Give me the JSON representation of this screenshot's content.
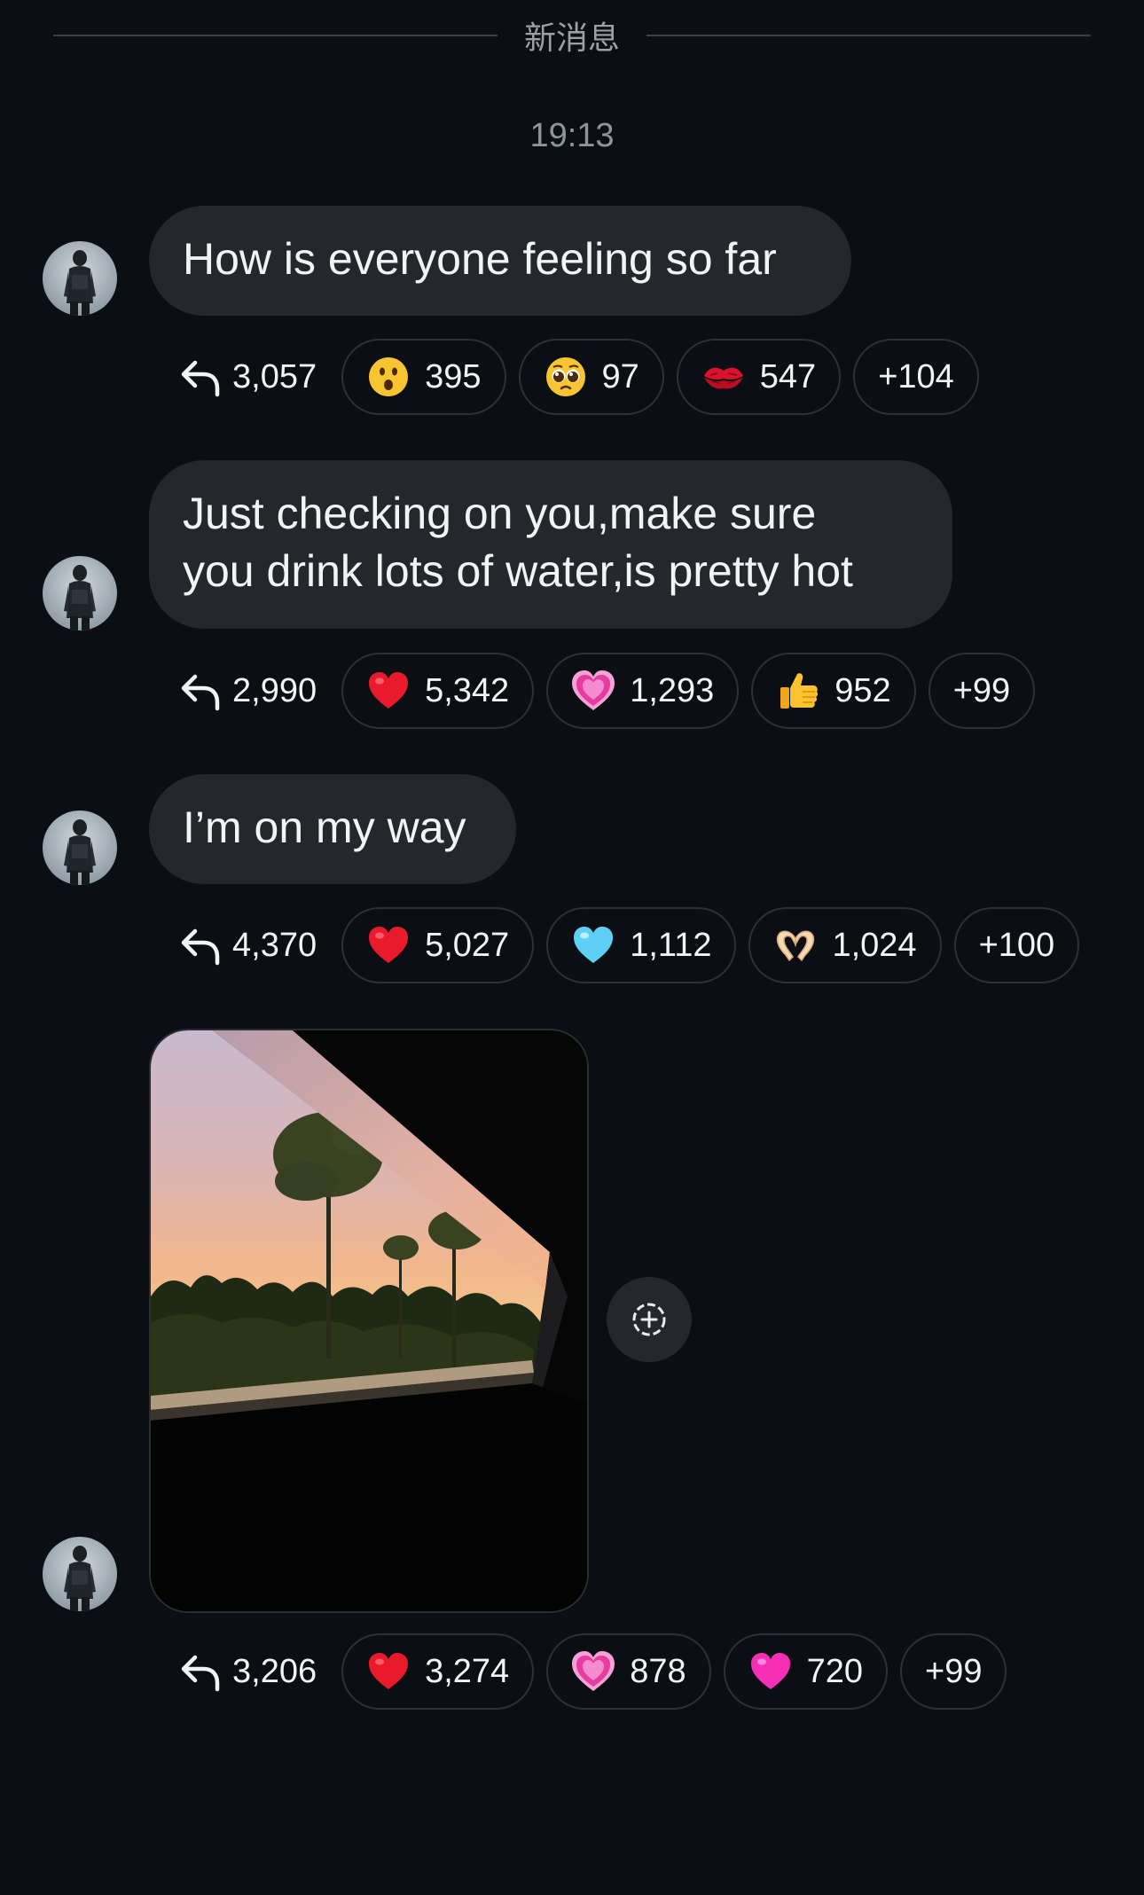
{
  "divider": {
    "label": "新消息"
  },
  "time": "19:13",
  "messages": [
    {
      "lines": [
        "How is everyone feeling so far"
      ],
      "replies": "3,057",
      "reactions": [
        {
          "emoji": "hushed-face-icon",
          "count": "395"
        },
        {
          "emoji": "pleading-face-icon",
          "count": "97"
        },
        {
          "emoji": "kiss-mark-icon",
          "count": "547"
        }
      ],
      "more": "+104"
    },
    {
      "lines": [
        "Just checking on you,make sure",
        "you drink lots of water,is pretty hot"
      ],
      "replies": "2,990",
      "reactions": [
        {
          "emoji": "red-heart-icon",
          "count": "5,342"
        },
        {
          "emoji": "growing-heart-icon",
          "count": "1,293"
        },
        {
          "emoji": "thumbs-up-icon",
          "count": "952"
        }
      ],
      "more": "+99"
    },
    {
      "lines": [
        "I’m on my way"
      ],
      "replies": "4,370",
      "reactions": [
        {
          "emoji": "red-heart-icon",
          "count": "5,027"
        },
        {
          "emoji": "light-blue-heart-icon",
          "count": "1,112"
        },
        {
          "emoji": "heart-hands-icon",
          "count": "1,024"
        }
      ],
      "more": "+100"
    },
    {
      "image": "sunset-trees-through-car-window",
      "replies": "3,206",
      "reactions": [
        {
          "emoji": "red-heart-icon",
          "count": "3,274"
        },
        {
          "emoji": "growing-heart-icon",
          "count": "878"
        },
        {
          "emoji": "pink-heart-icon",
          "count": "720"
        }
      ],
      "more": "+99"
    }
  ],
  "colors": {
    "background": "#0b0f14",
    "bubble": "#24272b",
    "chip_border": "#2c3137",
    "text": "#f2f3f5",
    "muted": "#8e949b"
  }
}
